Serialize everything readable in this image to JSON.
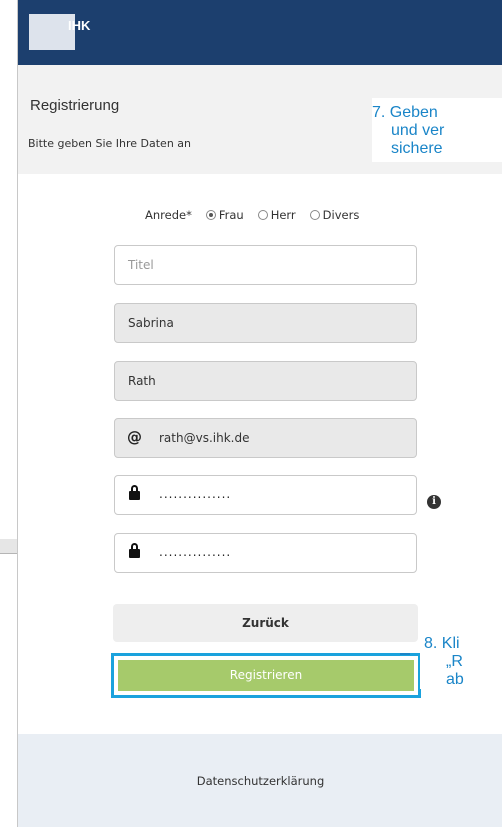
{
  "header": {
    "logo_text": "IHK",
    "background": "#1c3f6e"
  },
  "intro": {
    "title": "Registrierung",
    "subtitle": "Bitte geben Sie Ihre Daten an"
  },
  "form": {
    "anrede_label": "Anrede*",
    "anrede_options": [
      {
        "label": "Frau",
        "checked": true
      },
      {
        "label": "Herr",
        "checked": false
      },
      {
        "label": "Divers",
        "checked": false
      }
    ],
    "title_placeholder": "Titel",
    "firstname_value": "Sabrina",
    "lastname_value": "Rath",
    "email_value": "rath@vs.ihk.de",
    "password_value": "...............",
    "password_confirm_value": "..............."
  },
  "buttons": {
    "back_label": "Zurück",
    "register_label": "Registrieren",
    "register_color": "#a6ca6b",
    "highlight_color": "#1aa2dd"
  },
  "footer": {
    "privacy_label": "Datenschutzerklärung"
  },
  "callouts": {
    "step7": {
      "line1": "7. Geben",
      "line2": "und ver",
      "line3": "sichere"
    },
    "step8": {
      "line1": "8. Kli",
      "line2": "„R",
      "line3": "ab"
    },
    "color": "#1a85c8"
  }
}
